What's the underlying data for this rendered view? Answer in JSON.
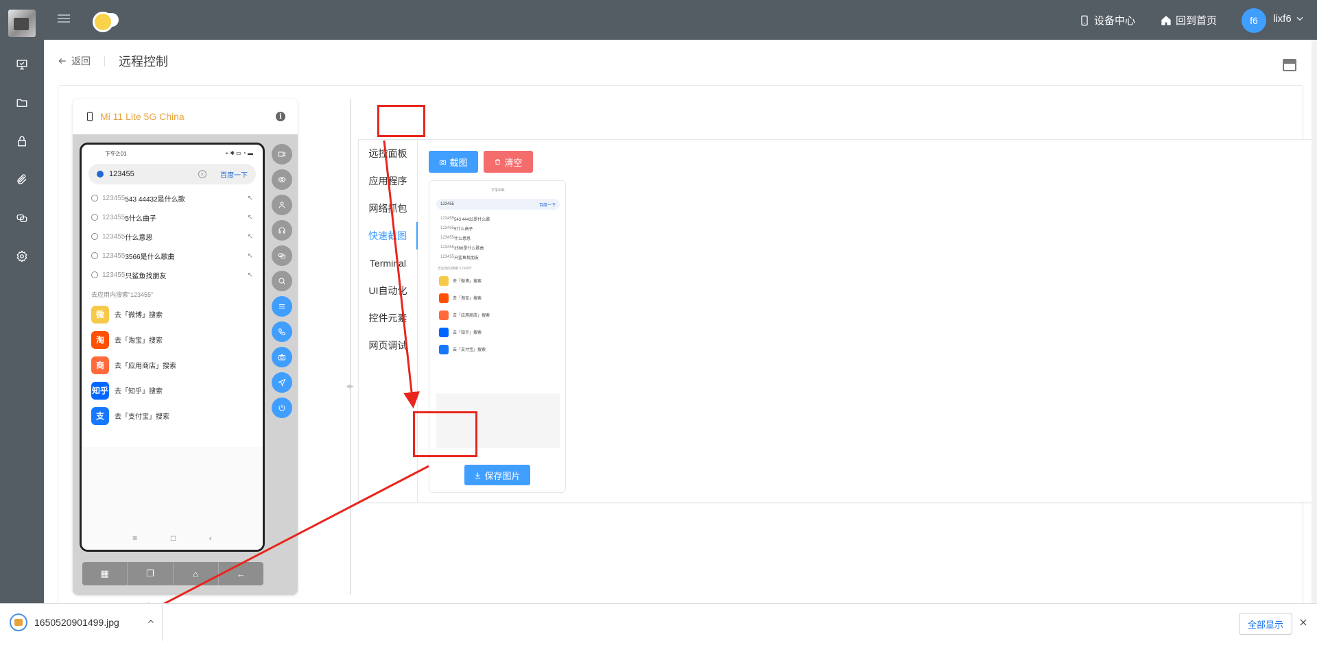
{
  "topbar": {
    "device_center": "设备中心",
    "home": "回到首页",
    "avatar": "f6",
    "username": "lixf6"
  },
  "header": {
    "back": "返回",
    "title": "远程控制"
  },
  "device": {
    "name": "Mi 11 Lite 5G China"
  },
  "phone": {
    "status_time": "下午2:01",
    "search_text": "123455",
    "search_button": "百度一下",
    "suggestions": [
      {
        "prefix": "123455",
        "rest": "543 44432是什么歌"
      },
      {
        "prefix": "123455",
        "rest": "5什么曲子"
      },
      {
        "prefix": "123455",
        "rest": "什么意思"
      },
      {
        "prefix": "123455",
        "rest": "3566是什么歌曲"
      },
      {
        "prefix": "123455",
        "rest": "只鲨鱼找朋友"
      }
    ],
    "section_label": "去应用内搜索“123455”",
    "apps": [
      {
        "label": "去「微博」搜索",
        "color": "#f7c948"
      },
      {
        "label": "去「淘宝」搜索",
        "color": "#ff5000"
      },
      {
        "label": "去「应用商店」搜索",
        "color": "#ff6a3d"
      },
      {
        "label": "去「知乎」搜索",
        "color": "#0066ff"
      },
      {
        "label": "去「支付宝」搜索",
        "color": "#1677ff"
      }
    ],
    "app_glyphs": [
      "微",
      "淘",
      "商",
      "知乎",
      "支"
    ]
  },
  "tabs": [
    "远控面板",
    "应用程序",
    "网络抓包",
    "快速截图",
    "Terminal",
    "UI自动化",
    "控件元素",
    "网页调试"
  ],
  "active_tab": "快速截图",
  "actions": {
    "capture": "截图",
    "clear": "清空",
    "save": "保存图片"
  },
  "download": {
    "filename": "1650520901499.jpg",
    "show_all": "全部显示"
  },
  "colors": {
    "primary": "#409eff",
    "danger": "#f56c6c",
    "sidebar": "#545c64",
    "annotation": "#e8261e"
  }
}
